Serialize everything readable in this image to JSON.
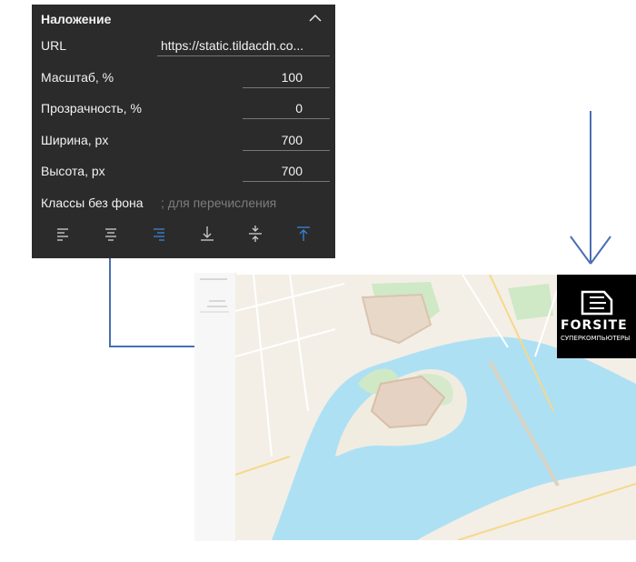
{
  "panel": {
    "title": "Наложение",
    "fields": [
      {
        "label": "URL",
        "value": "https://static.tildacdn.co..."
      },
      {
        "label": "Масштаб, %",
        "value": "100"
      },
      {
        "label": "Прозрачность, %",
        "value": "0"
      },
      {
        "label": "Ширина, px",
        "value": "700"
      },
      {
        "label": "Высота, px",
        "value": "700"
      },
      {
        "label": "Классы без фона",
        "placeholder": "; для перечисления"
      }
    ],
    "toolbar": [
      {
        "icon": "align-left-icon"
      },
      {
        "icon": "align-center-icon"
      },
      {
        "icon": "align-right-icon",
        "active": true
      },
      {
        "icon": "align-bottom-icon"
      },
      {
        "icon": "align-middle-icon"
      },
      {
        "icon": "align-top-icon",
        "active": true
      }
    ]
  },
  "logo": {
    "brand": "FORSITE",
    "tagline": "СУПЕРКОМПЬЮТЕРЫ"
  },
  "colors": {
    "panel_bg": "#2b2b2b",
    "active_icon": "#3b86d6",
    "connector": "#4a6eb3",
    "water": "#aee0f4",
    "land": "#f3efe6"
  }
}
